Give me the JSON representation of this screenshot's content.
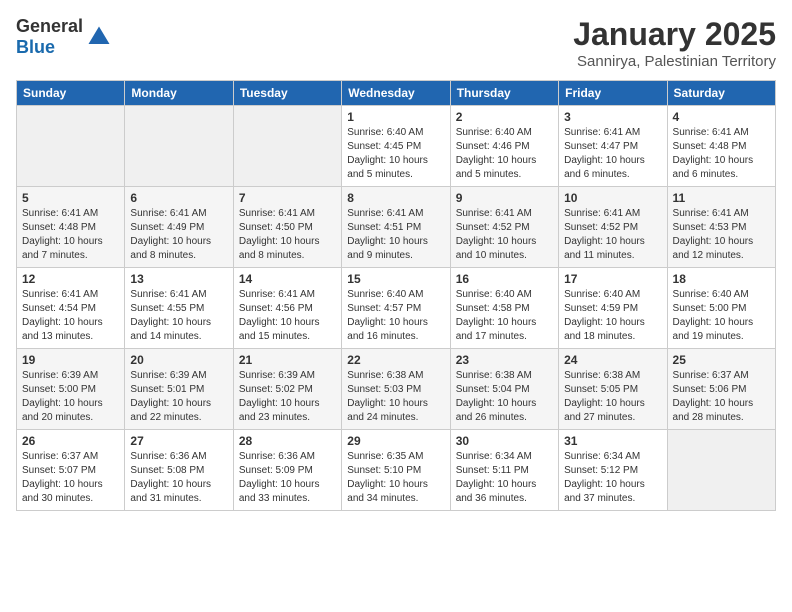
{
  "header": {
    "logo_general": "General",
    "logo_blue": "Blue",
    "month_title": "January 2025",
    "location": "Sannirya, Palestinian Territory"
  },
  "days_of_week": [
    "Sunday",
    "Monday",
    "Tuesday",
    "Wednesday",
    "Thursday",
    "Friday",
    "Saturday"
  ],
  "weeks": [
    [
      {
        "day": "",
        "sunrise": "",
        "sunset": "",
        "daylight": "",
        "empty": true
      },
      {
        "day": "",
        "sunrise": "",
        "sunset": "",
        "daylight": "",
        "empty": true
      },
      {
        "day": "",
        "sunrise": "",
        "sunset": "",
        "daylight": "",
        "empty": true
      },
      {
        "day": "1",
        "sunrise": "Sunrise: 6:40 AM",
        "sunset": "Sunset: 4:45 PM",
        "daylight": "Daylight: 10 hours and 5 minutes."
      },
      {
        "day": "2",
        "sunrise": "Sunrise: 6:40 AM",
        "sunset": "Sunset: 4:46 PM",
        "daylight": "Daylight: 10 hours and 5 minutes."
      },
      {
        "day": "3",
        "sunrise": "Sunrise: 6:41 AM",
        "sunset": "Sunset: 4:47 PM",
        "daylight": "Daylight: 10 hours and 6 minutes."
      },
      {
        "day": "4",
        "sunrise": "Sunrise: 6:41 AM",
        "sunset": "Sunset: 4:48 PM",
        "daylight": "Daylight: 10 hours and 6 minutes."
      }
    ],
    [
      {
        "day": "5",
        "sunrise": "Sunrise: 6:41 AM",
        "sunset": "Sunset: 4:48 PM",
        "daylight": "Daylight: 10 hours and 7 minutes."
      },
      {
        "day": "6",
        "sunrise": "Sunrise: 6:41 AM",
        "sunset": "Sunset: 4:49 PM",
        "daylight": "Daylight: 10 hours and 8 minutes."
      },
      {
        "day": "7",
        "sunrise": "Sunrise: 6:41 AM",
        "sunset": "Sunset: 4:50 PM",
        "daylight": "Daylight: 10 hours and 8 minutes."
      },
      {
        "day": "8",
        "sunrise": "Sunrise: 6:41 AM",
        "sunset": "Sunset: 4:51 PM",
        "daylight": "Daylight: 10 hours and 9 minutes."
      },
      {
        "day": "9",
        "sunrise": "Sunrise: 6:41 AM",
        "sunset": "Sunset: 4:52 PM",
        "daylight": "Daylight: 10 hours and 10 minutes."
      },
      {
        "day": "10",
        "sunrise": "Sunrise: 6:41 AM",
        "sunset": "Sunset: 4:52 PM",
        "daylight": "Daylight: 10 hours and 11 minutes."
      },
      {
        "day": "11",
        "sunrise": "Sunrise: 6:41 AM",
        "sunset": "Sunset: 4:53 PM",
        "daylight": "Daylight: 10 hours and 12 minutes."
      }
    ],
    [
      {
        "day": "12",
        "sunrise": "Sunrise: 6:41 AM",
        "sunset": "Sunset: 4:54 PM",
        "daylight": "Daylight: 10 hours and 13 minutes."
      },
      {
        "day": "13",
        "sunrise": "Sunrise: 6:41 AM",
        "sunset": "Sunset: 4:55 PM",
        "daylight": "Daylight: 10 hours and 14 minutes."
      },
      {
        "day": "14",
        "sunrise": "Sunrise: 6:41 AM",
        "sunset": "Sunset: 4:56 PM",
        "daylight": "Daylight: 10 hours and 15 minutes."
      },
      {
        "day": "15",
        "sunrise": "Sunrise: 6:40 AM",
        "sunset": "Sunset: 4:57 PM",
        "daylight": "Daylight: 10 hours and 16 minutes."
      },
      {
        "day": "16",
        "sunrise": "Sunrise: 6:40 AM",
        "sunset": "Sunset: 4:58 PM",
        "daylight": "Daylight: 10 hours and 17 minutes."
      },
      {
        "day": "17",
        "sunrise": "Sunrise: 6:40 AM",
        "sunset": "Sunset: 4:59 PM",
        "daylight": "Daylight: 10 hours and 18 minutes."
      },
      {
        "day": "18",
        "sunrise": "Sunrise: 6:40 AM",
        "sunset": "Sunset: 5:00 PM",
        "daylight": "Daylight: 10 hours and 19 minutes."
      }
    ],
    [
      {
        "day": "19",
        "sunrise": "Sunrise: 6:39 AM",
        "sunset": "Sunset: 5:00 PM",
        "daylight": "Daylight: 10 hours and 20 minutes."
      },
      {
        "day": "20",
        "sunrise": "Sunrise: 6:39 AM",
        "sunset": "Sunset: 5:01 PM",
        "daylight": "Daylight: 10 hours and 22 minutes."
      },
      {
        "day": "21",
        "sunrise": "Sunrise: 6:39 AM",
        "sunset": "Sunset: 5:02 PM",
        "daylight": "Daylight: 10 hours and 23 minutes."
      },
      {
        "day": "22",
        "sunrise": "Sunrise: 6:38 AM",
        "sunset": "Sunset: 5:03 PM",
        "daylight": "Daylight: 10 hours and 24 minutes."
      },
      {
        "day": "23",
        "sunrise": "Sunrise: 6:38 AM",
        "sunset": "Sunset: 5:04 PM",
        "daylight": "Daylight: 10 hours and 26 minutes."
      },
      {
        "day": "24",
        "sunrise": "Sunrise: 6:38 AM",
        "sunset": "Sunset: 5:05 PM",
        "daylight": "Daylight: 10 hours and 27 minutes."
      },
      {
        "day": "25",
        "sunrise": "Sunrise: 6:37 AM",
        "sunset": "Sunset: 5:06 PM",
        "daylight": "Daylight: 10 hours and 28 minutes."
      }
    ],
    [
      {
        "day": "26",
        "sunrise": "Sunrise: 6:37 AM",
        "sunset": "Sunset: 5:07 PM",
        "daylight": "Daylight: 10 hours and 30 minutes."
      },
      {
        "day": "27",
        "sunrise": "Sunrise: 6:36 AM",
        "sunset": "Sunset: 5:08 PM",
        "daylight": "Daylight: 10 hours and 31 minutes."
      },
      {
        "day": "28",
        "sunrise": "Sunrise: 6:36 AM",
        "sunset": "Sunset: 5:09 PM",
        "daylight": "Daylight: 10 hours and 33 minutes."
      },
      {
        "day": "29",
        "sunrise": "Sunrise: 6:35 AM",
        "sunset": "Sunset: 5:10 PM",
        "daylight": "Daylight: 10 hours and 34 minutes."
      },
      {
        "day": "30",
        "sunrise": "Sunrise: 6:34 AM",
        "sunset": "Sunset: 5:11 PM",
        "daylight": "Daylight: 10 hours and 36 minutes."
      },
      {
        "day": "31",
        "sunrise": "Sunrise: 6:34 AM",
        "sunset": "Sunset: 5:12 PM",
        "daylight": "Daylight: 10 hours and 37 minutes."
      },
      {
        "day": "",
        "sunrise": "",
        "sunset": "",
        "daylight": "",
        "empty": true
      }
    ]
  ]
}
